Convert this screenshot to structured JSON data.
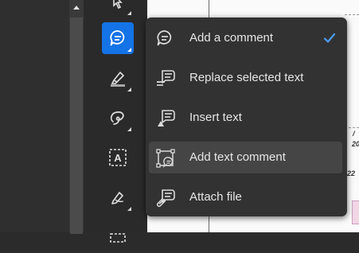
{
  "menu": {
    "items": [
      {
        "label": "Add a comment",
        "icon": "comment-icon",
        "checked": true
      },
      {
        "label": "Replace selected text",
        "icon": "replace-text-icon"
      },
      {
        "label": "Insert text",
        "icon": "insert-text-icon"
      },
      {
        "label": "Add text comment",
        "icon": "text-comment-icon",
        "hovered": true
      },
      {
        "label": "Attach file",
        "icon": "attach-file-icon"
      }
    ]
  },
  "toolbar": {
    "tools": [
      {
        "icon": "select-arrow-icon"
      },
      {
        "icon": "comment-icon",
        "active": true
      },
      {
        "icon": "highlighter-icon"
      },
      {
        "icon": "freehand-draw-icon"
      },
      {
        "icon": "text-box-icon",
        "glyph": "A"
      },
      {
        "icon": "signature-pen-icon"
      },
      {
        "icon": "stamp-icon"
      }
    ]
  },
  "document": {
    "cells": [
      "/",
      "20",
      "22"
    ]
  },
  "colors": {
    "accent": "#1473e6",
    "check": "#4b9cf5",
    "menu_bg": "#323232",
    "menu_hover": "#454545",
    "menu_text": "#e6e6e6"
  }
}
